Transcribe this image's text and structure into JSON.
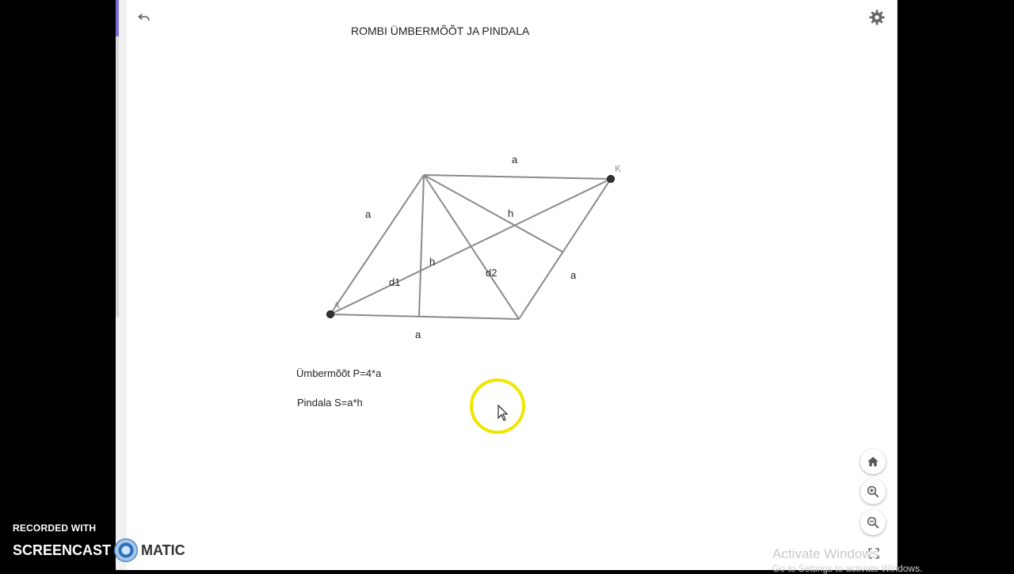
{
  "app": {
    "title": "ROMBI ÜMBERMÕÕT JA PINDALA"
  },
  "toolbar": {
    "undo_icon": "undo-icon",
    "settings_icon": "gear-icon"
  },
  "figure": {
    "point_labels": [
      "A",
      "K"
    ],
    "side_labels": [
      "a",
      "a",
      "a",
      "a"
    ],
    "height_labels": [
      "h",
      "h"
    ],
    "diagonal_labels": [
      "d1",
      "d2"
    ],
    "line_color": "#8a8a8a",
    "point_color": "#333333"
  },
  "formulas": {
    "perimeter": "Ümbermõõt P=4*a",
    "area": "Pindala S=a*h"
  },
  "view_controls": {
    "home_icon": "home-icon",
    "zoom_in_icon": "zoom-in-icon",
    "zoom_out_icon": "zoom-out-icon",
    "fullscreen_icon": "fullscreen-icon"
  },
  "overlay": {
    "recorder_top": "RECORDED WITH",
    "recorder_left": "SCREENCAST",
    "recorder_right": "MATIC",
    "activate_title": "Activate Windows",
    "activate_sub": "Go to Settings to activate Windows.",
    "cursor_highlight_color": "#f0e600"
  }
}
